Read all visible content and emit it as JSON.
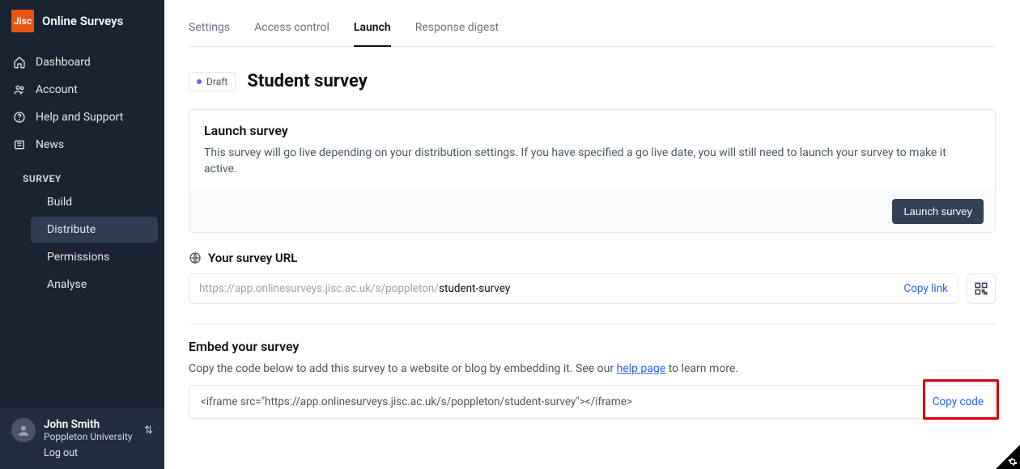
{
  "brand": {
    "logo": "Jisc",
    "title": "Online Surveys"
  },
  "sidebar": {
    "items": [
      {
        "label": "Dashboard"
      },
      {
        "label": "Account"
      },
      {
        "label": "Help and Support"
      },
      {
        "label": "News"
      }
    ],
    "section": "SURVEY",
    "survey_items": [
      {
        "label": "Build"
      },
      {
        "label": "Distribute"
      },
      {
        "label": "Permissions"
      },
      {
        "label": "Analyse"
      }
    ]
  },
  "user": {
    "name": "John Smith",
    "org": "Poppleton University",
    "logout": "Log out"
  },
  "tabs": [
    {
      "label": "Settings"
    },
    {
      "label": "Access control"
    },
    {
      "label": "Launch"
    },
    {
      "label": "Response digest"
    }
  ],
  "status": "Draft",
  "page_title": "Student survey",
  "launch_card": {
    "title": "Launch survey",
    "text": "This survey will go live depending on your distribution settings. If you have specified a go live date, you will still need to launch your survey to make it active.",
    "button": "Launch survey"
  },
  "url_section": {
    "title": "Your survey URL",
    "prefix": "https://app.onlinesurveys.jisc.ac.uk/s/poppleton/ ",
    "slug": "student-survey",
    "copy": "Copy link"
  },
  "embed_section": {
    "title": "Embed your survey",
    "desc_pre": "Copy the code below to add this survey to a website or blog by embedding it. See our ",
    "link": "help page",
    "desc_post": " to learn more.",
    "code": "<iframe src=\"https://app.onlinesurveys.jisc.ac.uk/s/poppleton/student-survey\"></iframe>",
    "copy": "Copy code"
  }
}
